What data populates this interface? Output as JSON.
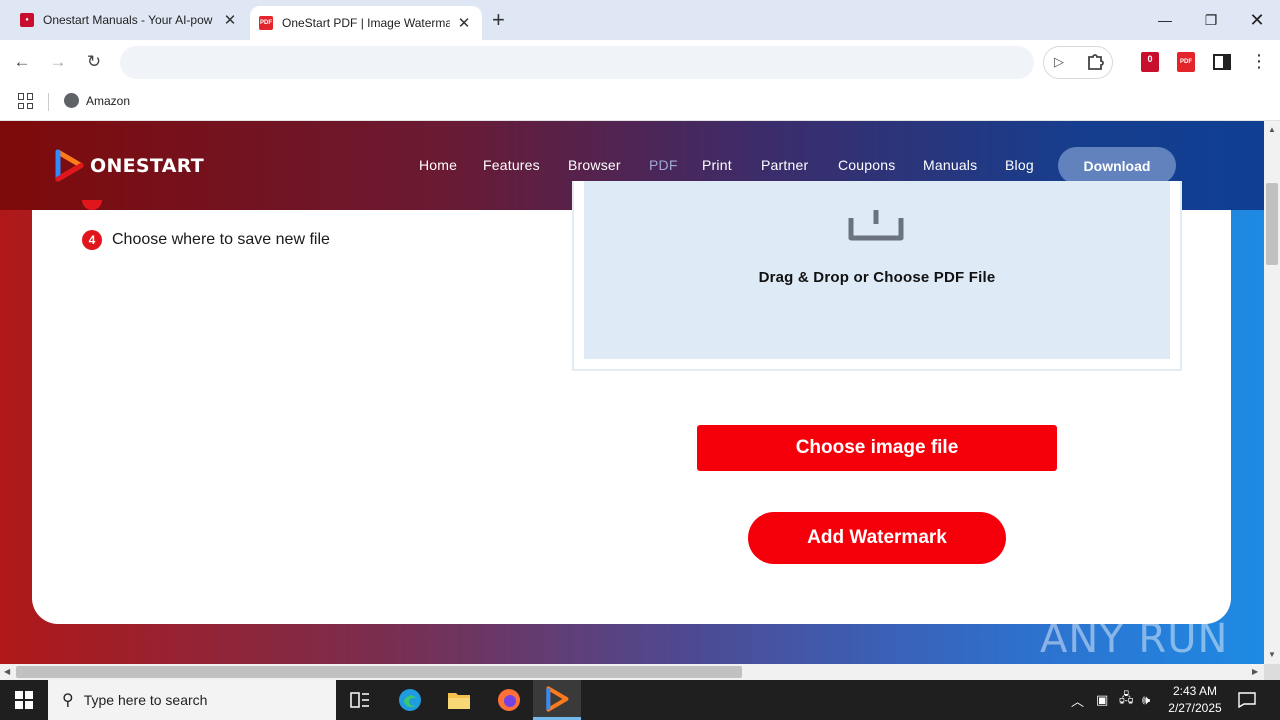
{
  "browser": {
    "tabs": [
      {
        "title": "Onestart Manuals - Your AI-pow",
        "active": false
      },
      {
        "title": "OneStart PDF | Image Watermar",
        "active": true
      }
    ],
    "address_placeholder": "",
    "bookmarks": [
      {
        "label": "Amazon"
      }
    ],
    "pdf_extension_label": "PDF"
  },
  "site": {
    "logo_text": "ONESTART",
    "nav": [
      "Home",
      "Features",
      "Browser",
      "PDF",
      "Print",
      "Partner",
      "Coupons",
      "Manuals",
      "Blog"
    ],
    "current_nav": "PDF",
    "download_label": "Download"
  },
  "content": {
    "steps": [
      {
        "number": "4",
        "text": "Choose where to save new file"
      }
    ],
    "drop_zone_label": "Drag & Drop or Choose PDF File",
    "choose_image_label": "Choose image file",
    "add_watermark_label": "Add Watermark"
  },
  "watermark": {
    "text": "ANY RUN"
  },
  "taskbar": {
    "search_placeholder": "Type here to search",
    "time": "2:43 AM",
    "date": "2/27/2025"
  },
  "colors": {
    "brand_red": "#f5000a",
    "download_button": "#6182bd",
    "drop_zone_bg": "#deebf7"
  }
}
